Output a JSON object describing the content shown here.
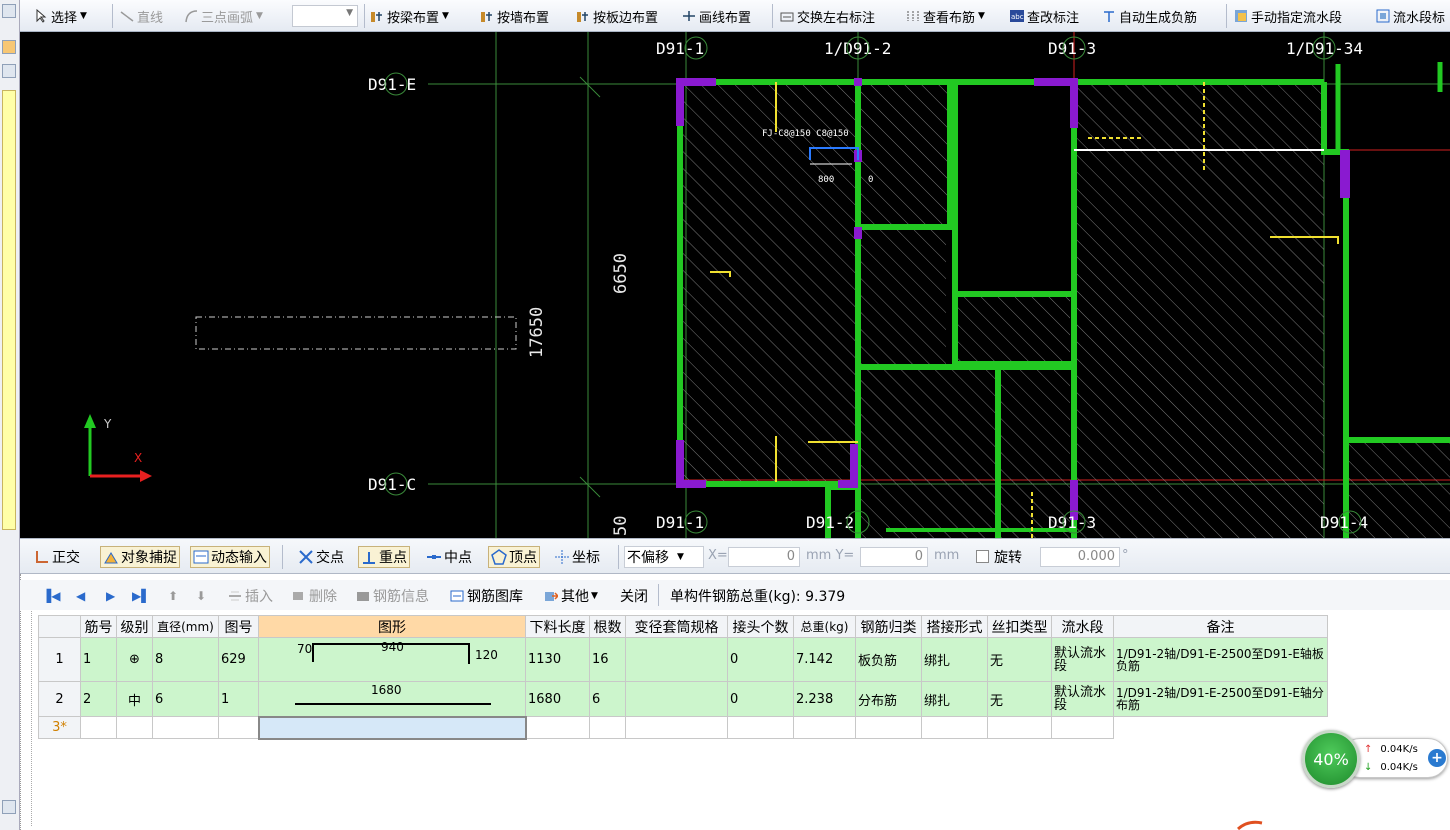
{
  "toolbar": {
    "select": "选择",
    "line": "直线",
    "arc": "三点画弧",
    "by_beam": "按梁布置",
    "by_wall": "按墙布置",
    "by_slab_edge": "按板边布置",
    "by_line": "画线布置",
    "swap_labels": "交换左右标注",
    "view_rebar": "查看布筋",
    "edit_label": "查改标注",
    "auto_neg": "自动生成负筋",
    "manual_flow": "手动指定流水段",
    "flow_seg": "流水段标"
  },
  "canvas": {
    "axis_top": [
      "D91-1",
      "1/D91-2",
      "D91-3",
      "1/D91-34"
    ],
    "axis_bottom": [
      "D91-1",
      "D91-2",
      "D91-3",
      "D91-4"
    ],
    "axis_left": [
      "D91-E",
      "D91-C"
    ],
    "dim_6650": "6650",
    "dim_17650": "17650",
    "dim_bottom": "50",
    "rebar_label": "FJ-C8@150 C8@150",
    "rebar_800": "800",
    "rebar_0": "0",
    "ucs_x": "X",
    "ucs_y": "Y"
  },
  "snapbar": {
    "ortho": "正交",
    "snap": "对象捕捉",
    "dyn": "动态输入",
    "intersect": "交点",
    "perp": "重点",
    "mid": "中点",
    "vertex": "顶点",
    "coord": "坐标",
    "offset_mode": "不偏移",
    "x_label": "X=",
    "x_value": "0",
    "y_label": "mm Y=",
    "y_value": "0",
    "mm": "mm",
    "rotate": "旋转",
    "rotate_value": "0.000",
    "deg": "°"
  },
  "rebarbar": {
    "insert": "插入",
    "delete": "删除",
    "info": "钢筋信息",
    "library": "钢筋图库",
    "other": "其他",
    "close": "关闭",
    "total": "单构件钢筋总重(kg): 9.379"
  },
  "table": {
    "headers": [
      "",
      "筋号",
      "级别",
      "直径(mm)",
      "图号",
      "图形",
      "下料长度",
      "根数",
      "变径套筒规格",
      "接头个数",
      "总重(kg)",
      "钢筋归类",
      "搭接形式",
      "丝扣类型",
      "流水段",
      "备注"
    ],
    "rows": [
      {
        "idx": "1",
        "no": "1",
        "grade": "⊕",
        "dia": "8",
        "fig": "629",
        "s_left": "70",
        "s_mid": "940",
        "s_right": "120",
        "len": "1130",
        "count": "16",
        "sleeve": "",
        "joints": "0",
        "weight": "7.142",
        "cat": "板负筋",
        "lap": "绑扎",
        "thread": "无",
        "flow": "默认流水段",
        "note": "1/D91-2轴/D91-E-2500至D91-E轴板负筋"
      },
      {
        "idx": "2",
        "no": "2",
        "grade": "中",
        "dia": "6",
        "fig": "1",
        "s_mid": "1680",
        "len": "1680",
        "count": "6",
        "sleeve": "",
        "joints": "0",
        "weight": "2.238",
        "cat": "分布筋",
        "lap": "绑扎",
        "thread": "无",
        "flow": "默认流水段",
        "note": "1/D91-2轴/D91-E-2500至D91-E轴分布筋"
      }
    ],
    "new_row": "3*"
  },
  "speed": {
    "percent": "40%",
    "up": "0.04K/s",
    "down": "0.04K/s"
  }
}
